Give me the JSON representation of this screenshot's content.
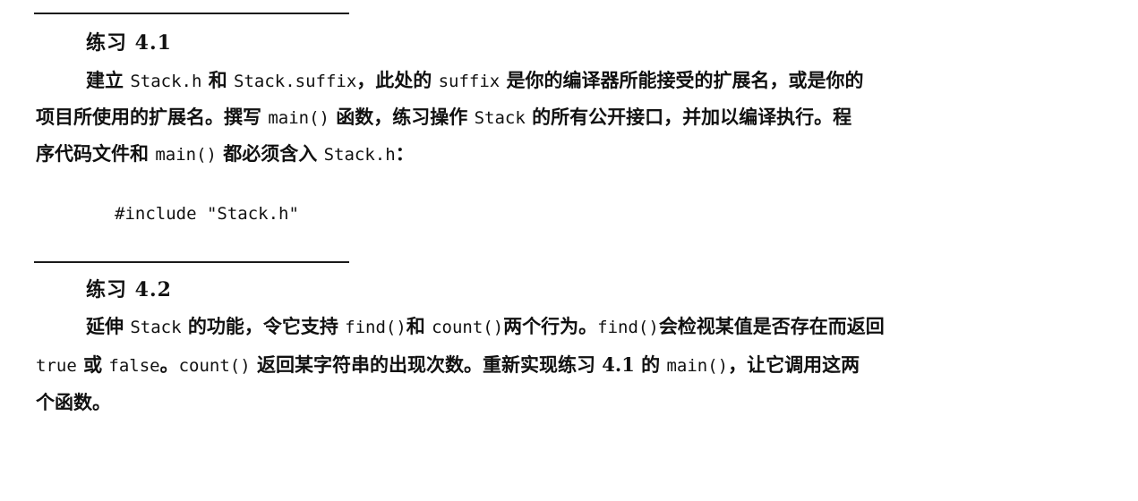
{
  "exercise1": {
    "title": "练习 4.1",
    "line1": [
      {
        "t": "建立 ",
        "code": false
      },
      {
        "t": "Stack.h",
        "code": true
      },
      {
        "t": " 和 ",
        "code": false
      },
      {
        "t": "Stack.suffix",
        "code": true
      },
      {
        "t": "，此处的 ",
        "code": false
      },
      {
        "t": "suffix",
        "code": true
      },
      {
        "t": " 是你的编译器所能接受的扩展名，或是你的",
        "code": false
      }
    ],
    "line2": [
      {
        "t": "项目所使用的扩展名。撰写 ",
        "code": false
      },
      {
        "t": "main()",
        "code": true
      },
      {
        "t": " 函数，练习操作 ",
        "code": false
      },
      {
        "t": "Stack",
        "code": true
      },
      {
        "t": " 的所有公开接口，并加以编译执行。程",
        "code": false
      }
    ],
    "line3": [
      {
        "t": "序代码文件和 ",
        "code": false
      },
      {
        "t": "main()",
        "code": true
      },
      {
        "t": " 都必须含入 ",
        "code": false
      },
      {
        "t": "Stack.h",
        "code": true
      },
      {
        "t": "：",
        "code": false
      }
    ],
    "code": "#include \"Stack.h\""
  },
  "exercise2": {
    "title": "练习 4.2",
    "line1": [
      {
        "t": "延伸 ",
        "code": false
      },
      {
        "t": "Stack",
        "code": true
      },
      {
        "t": " 的功能，令它支持 ",
        "code": false
      },
      {
        "t": "find()",
        "code": true
      },
      {
        "t": "和 ",
        "code": false
      },
      {
        "t": "count()",
        "code": true
      },
      {
        "t": "两个行为。",
        "code": false
      },
      {
        "t": "find()",
        "code": true
      },
      {
        "t": "会检视某值是否存在而返回",
        "code": false
      }
    ],
    "line2": [
      {
        "t": "true",
        "code": true
      },
      {
        "t": " 或 ",
        "code": false
      },
      {
        "t": "false",
        "code": true
      },
      {
        "t": "。",
        "code": false
      },
      {
        "t": "count()",
        "code": true
      },
      {
        "t": " 返回某字符串的出现次数。重新实现练习 4.1 的 ",
        "code": false
      },
      {
        "t": "main()",
        "code": true
      },
      {
        "t": "，让它调用这两",
        "code": false
      }
    ],
    "line3": [
      {
        "t": "个函数。",
        "code": false
      }
    ]
  }
}
